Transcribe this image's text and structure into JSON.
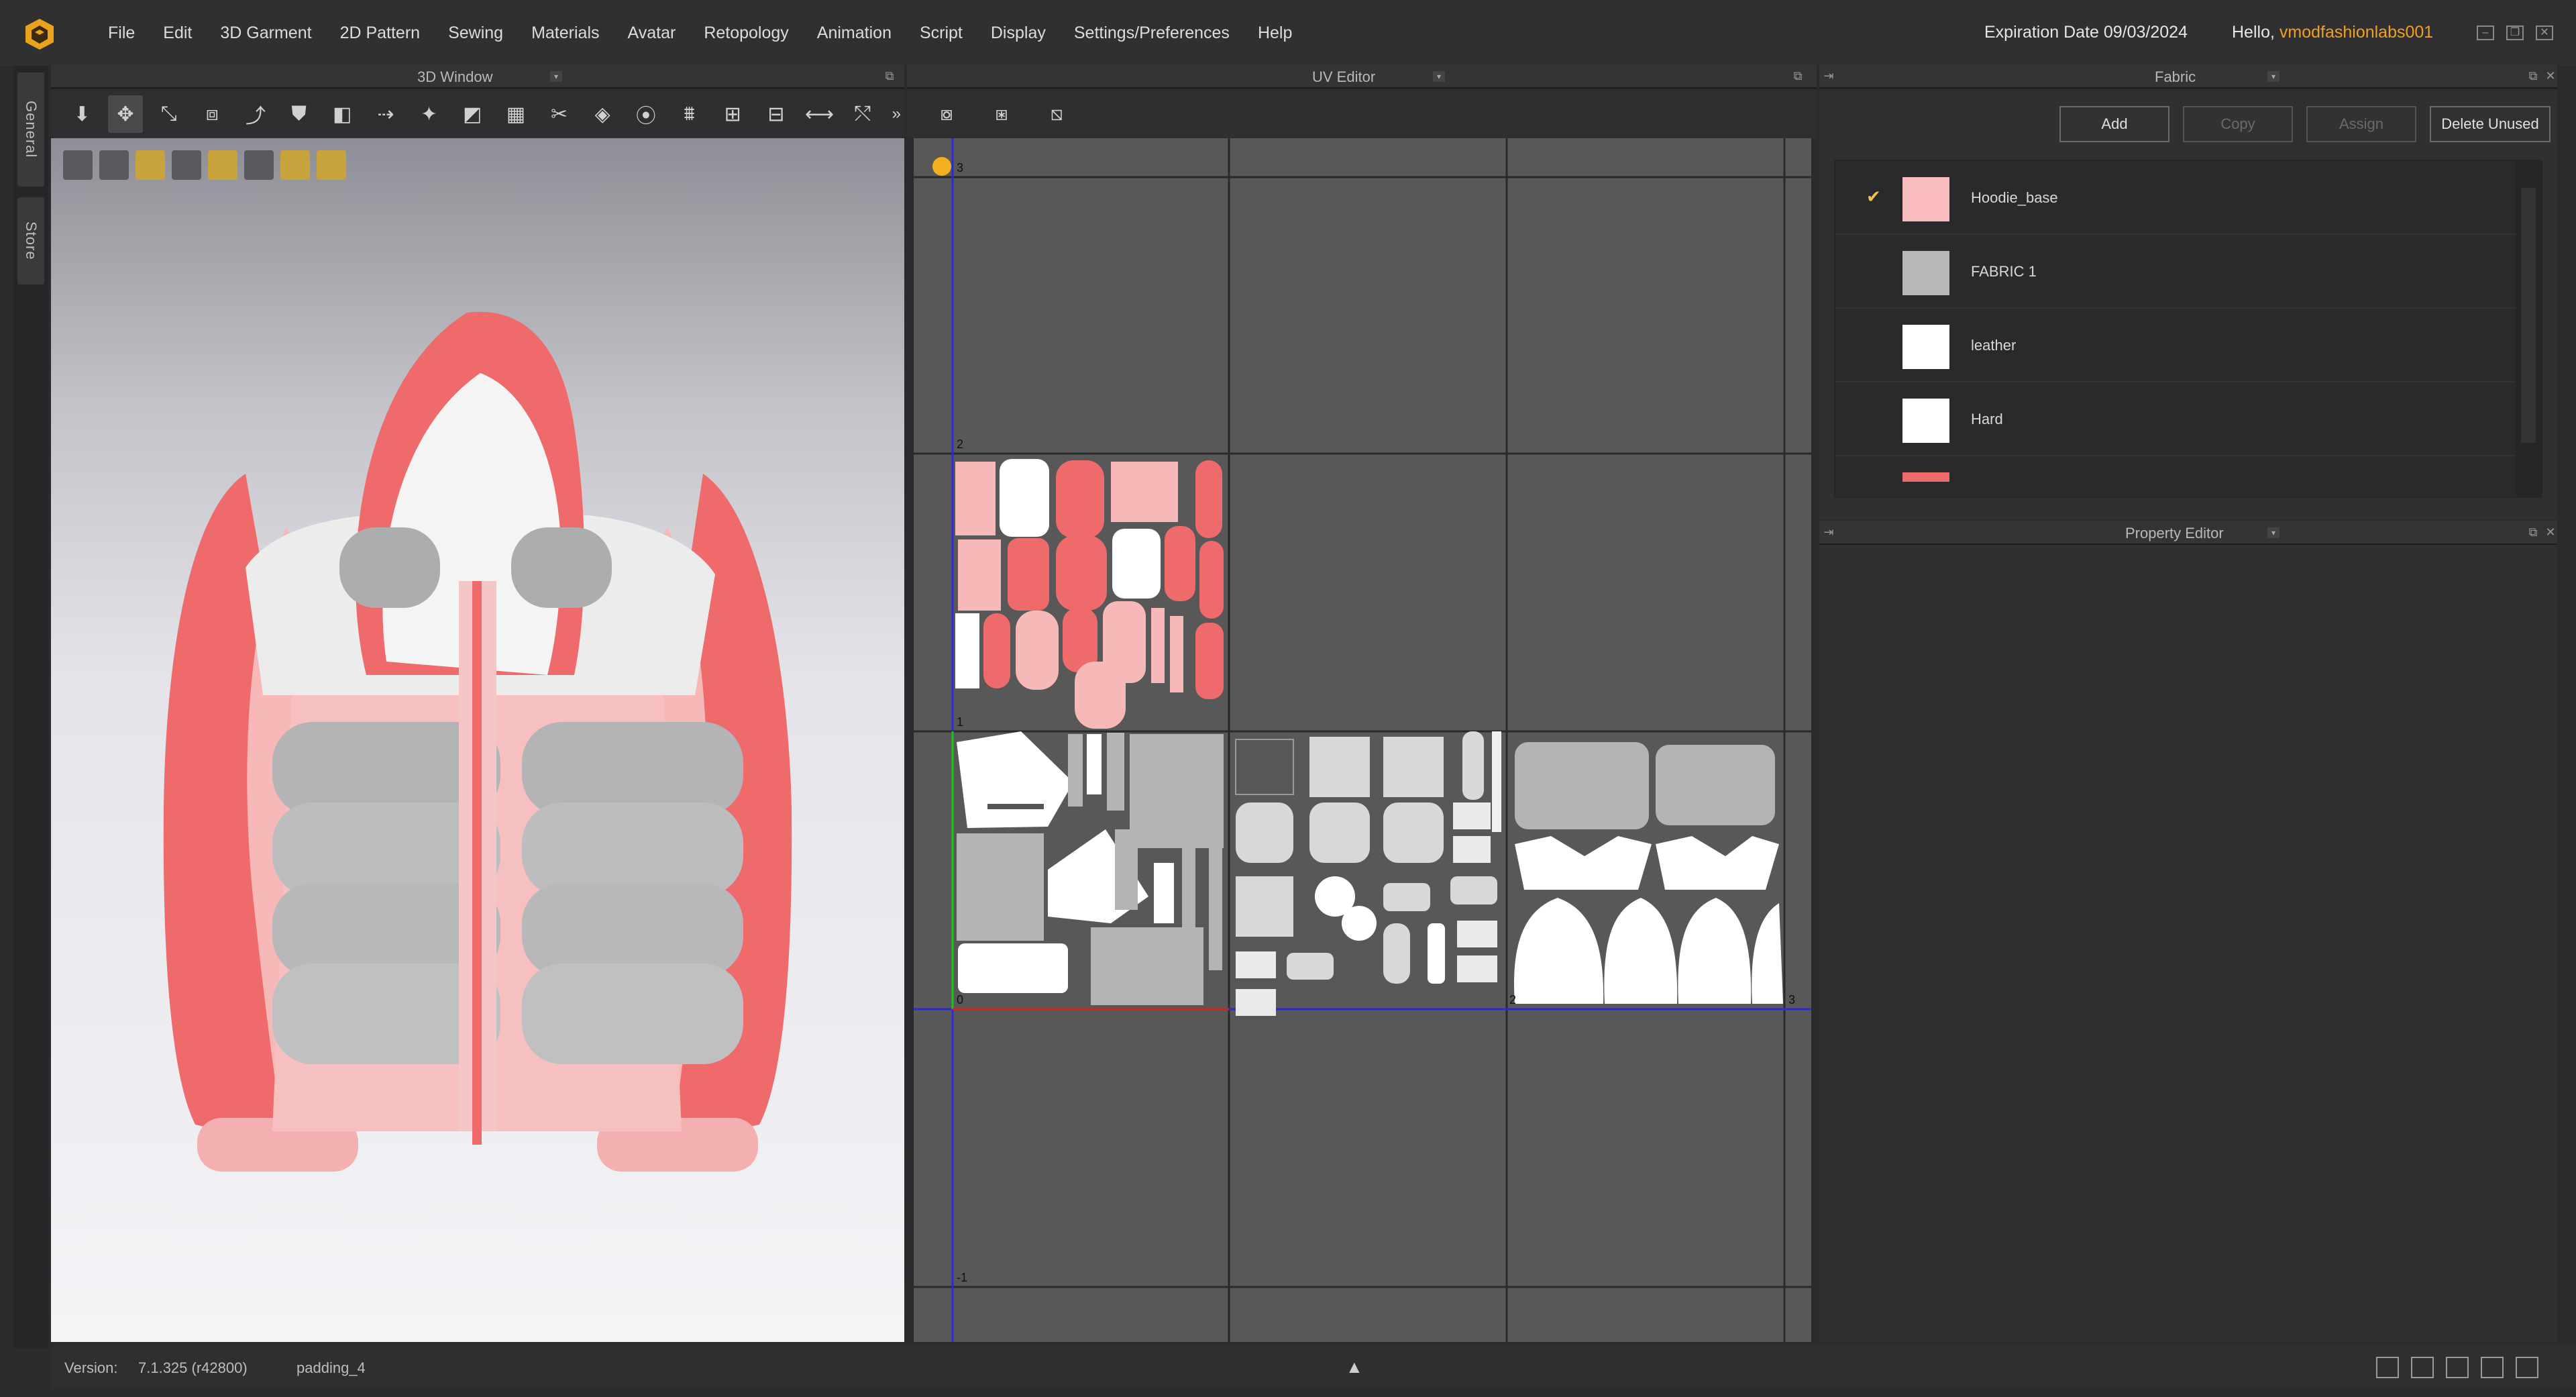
{
  "menubar": {
    "items": [
      "File",
      "Edit",
      "3D Garment",
      "2D Pattern",
      "Sewing",
      "Materials",
      "Avatar",
      "Retopology",
      "Animation",
      "Script",
      "Display",
      "Settings/Preferences",
      "Help"
    ],
    "expiration": "Expiration Date 09/03/2024",
    "hello_prefix": "Hello, ",
    "username": "vmodfashionlabs001"
  },
  "side_tabs": {
    "general": "General",
    "store": "Store"
  },
  "panels": {
    "window3d": "3D Window",
    "uv_editor": "UV Editor",
    "fabric": "Fabric",
    "property_editor": "Property Editor"
  },
  "uv_labels": {
    "row3": "3",
    "row2": "2",
    "row1": "1",
    "row0": "0",
    "rowneg1": "-1",
    "col2": "2",
    "col3": "3"
  },
  "fabric": {
    "buttons": {
      "add": "Add",
      "copy": "Copy",
      "assign": "Assign",
      "delete_unused": "Delete Unused"
    },
    "items": [
      {
        "name": "Hoodie_base",
        "color": "#f8bcbc",
        "selected": true
      },
      {
        "name": "FABRIC 1",
        "color": "#b8b8b8",
        "selected": false
      },
      {
        "name": "leather",
        "color": "#ffffff",
        "selected": false
      },
      {
        "name": "Hard",
        "color": "#ffffff",
        "selected": false
      },
      {
        "name": "",
        "color": "#ef6b6b",
        "selected": false
      }
    ]
  },
  "status": {
    "version_label": "Version:",
    "version_value": "7.1.325 (r42800)",
    "padding": "padding_4"
  },
  "colors": {
    "coral": "#ef6b6b",
    "pink": "#f7b8b8",
    "gray_puffer": "#b4b4b6",
    "accent_user": "#f0a020"
  }
}
